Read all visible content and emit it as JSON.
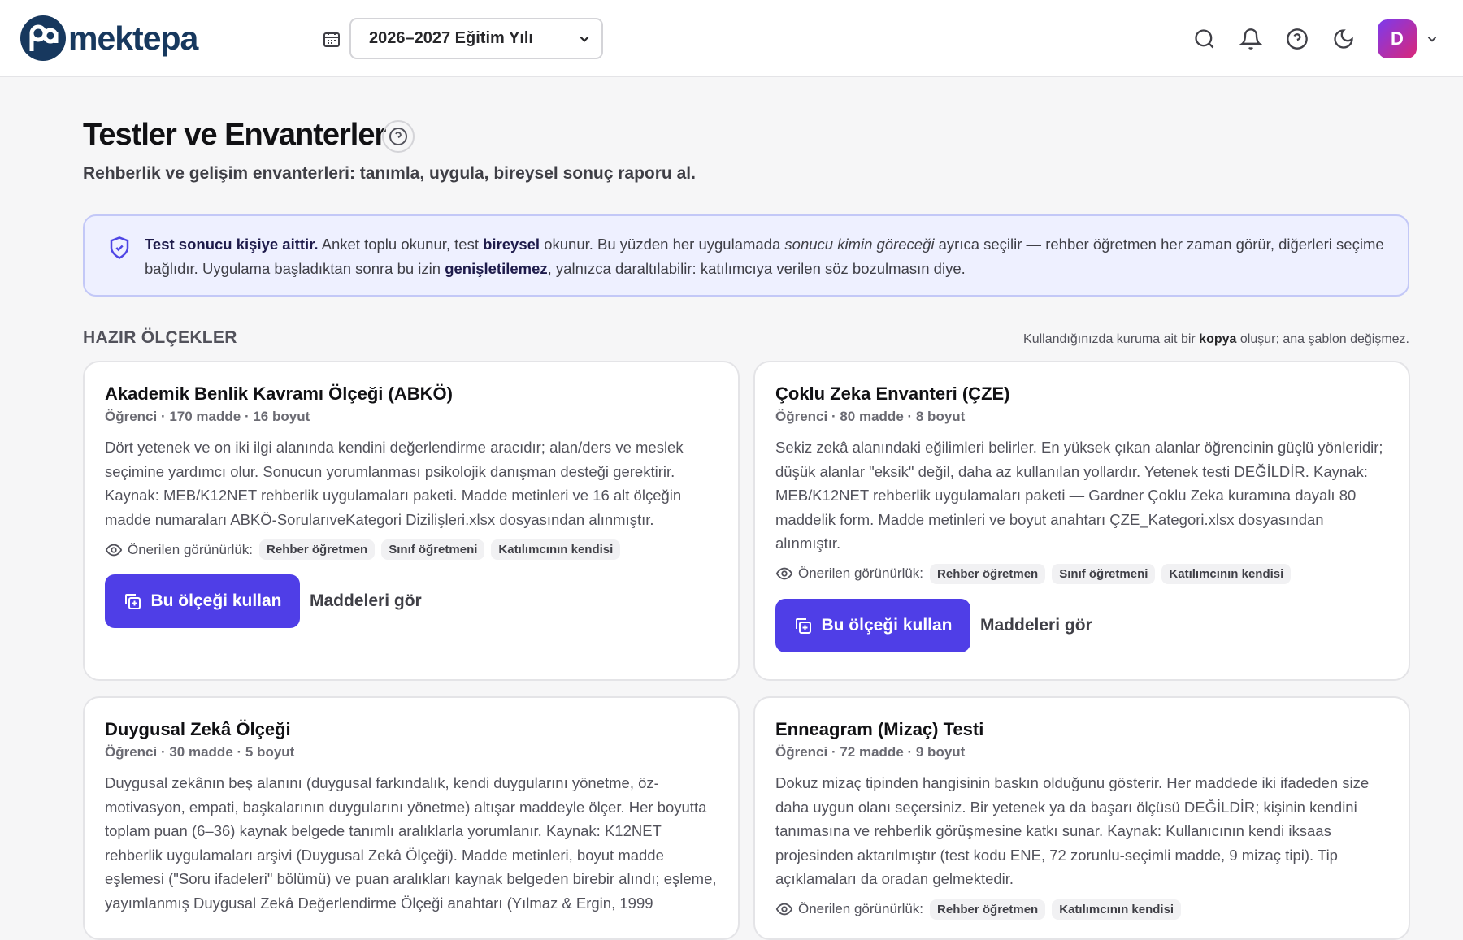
{
  "header": {
    "brand": "mektepa",
    "year_select": "2026–2027 Eğitim Yılı",
    "avatar_initial": "D",
    "icons": [
      "calendar-icon",
      "search-icon",
      "bell-icon",
      "help-icon",
      "moon-icon",
      "chevron-down-icon"
    ]
  },
  "page": {
    "title": "Testler ve Envanterler",
    "subtitle": "Rehberlik ve gelişim envanterleri: tanımla, uygula, bireysel sonuç raporu al."
  },
  "notice": {
    "lead": "Test sonucu kişiye aittir.",
    "t1": " Anket toplu okunur, test ",
    "b1": "bireysel",
    "t2": " okunur. Bu yüzden her uygulamada ",
    "i1": "sonucu kimin göreceği",
    "t3": " ayrıca seçilir — rehber öğretmen her zaman görür, diğerleri seçime bağlıdır. Uygulama başladıktan sonra bu izin ",
    "b2": "genişletilemez",
    "t4": ", yalnızca daraltılabilir: katılımcıya verilen söz bozulmasın diye."
  },
  "section": {
    "label": "HAZIR ÖLÇEKLER",
    "note_a": "Kullandığınızda kuruma ait bir ",
    "note_b": "kopya",
    "note_c": " oluşur; ana şablon değişmez."
  },
  "common": {
    "visibility_label": "Önerilen görünürlük:",
    "use_button": "Bu ölçeği kullan",
    "items_button": "Maddeleri gör"
  },
  "cards": [
    {
      "title": "Akademik Benlik Kavramı Ölçeği (ABKÖ)",
      "meta": "Öğrenci · 170 madde · 16 boyut",
      "desc": "Dört yetenek ve on iki ilgi alanında kendini değerlendirme aracıdır; alan/ders ve meslek seçimine yardımcı olur. Sonucun yorumlanması psikolojik danışman desteği gerektirir. Kaynak: MEB/K12NET rehberlik uygulamaları paketi. Madde metinleri ve 16 alt ölçeğin madde numaraları ABKÖ-SorularıveKategori Dizilişleri.xlsx dosyasından alınmıştır.",
      "chips": [
        "Rehber öğretmen",
        "Sınıf öğretmeni",
        "Katılımcının kendisi"
      ]
    },
    {
      "title": "Çoklu Zeka Envanteri (ÇZE)",
      "meta": "Öğrenci · 80 madde · 8 boyut",
      "desc": "Sekiz zekâ alanındaki eğilimleri belirler. En yüksek çıkan alanlar öğrencinin güçlü yönleridir; düşük alanlar \"eksik\" değil, daha az kullanılan yollardır. Yetenek testi DEĞİLDİR. Kaynak: MEB/K12NET rehberlik uygulamaları paketi — Gardner Çoklu Zeka kuramına dayalı 80 maddelik form. Madde metinleri ve boyut anahtarı ÇZE_Kategori.xlsx dosyasından alınmıştır.",
      "chips": [
        "Rehber öğretmen",
        "Sınıf öğretmeni",
        "Katılımcının kendisi"
      ]
    },
    {
      "title": "Duygusal Zekâ Ölçeği",
      "meta": "Öğrenci · 30 madde · 5 boyut",
      "desc": "Duygusal zekânın beş alanını (duygusal farkındalık, kendi duygularını yönetme, öz-motivasyon, empati, başkalarının duygularını yönetme) altışar maddeyle ölçer. Her boyutta toplam puan (6–36) kaynak belgede tanımlı aralıklarla yorumlanır. Kaynak: K12NET rehberlik uygulamaları arşivi (Duygusal Zekâ Ölçeği). Madde metinleri, boyut madde eşlemesi (\"Soru ifadeleri\" bölümü) ve puan aralıkları kaynak belgeden birebir alındı; eşleme, yayımlanmış Duygusal Zekâ Değerlendirme Ölçeği anahtarı (Yılmaz & Ergin, 1999",
      "chips": []
    },
    {
      "title": "Enneagram (Mizaç) Testi",
      "meta": "Öğrenci · 72 madde · 9 boyut",
      "desc": "Dokuz mizaç tipinden hangisinin baskın olduğunu gösterir. Her maddede iki ifadeden size daha uygun olanı seçersiniz. Bir yetenek ya da başarı ölçüsü DEĞİLDİR; kişinin kendini tanımasına ve rehberlik görüşmesine katkı sunar. Kaynak: Kullanıcının kendi iksaas projesinden aktarılmıştır (test kodu ENE, 72 zorunlu-seçimli madde, 9 mizaç tipi). Tip açıklamaları da oradan gelmektedir.",
      "chips": [
        "Rehber öğretmen",
        "Katılımcının kendisi"
      ]
    }
  ]
}
